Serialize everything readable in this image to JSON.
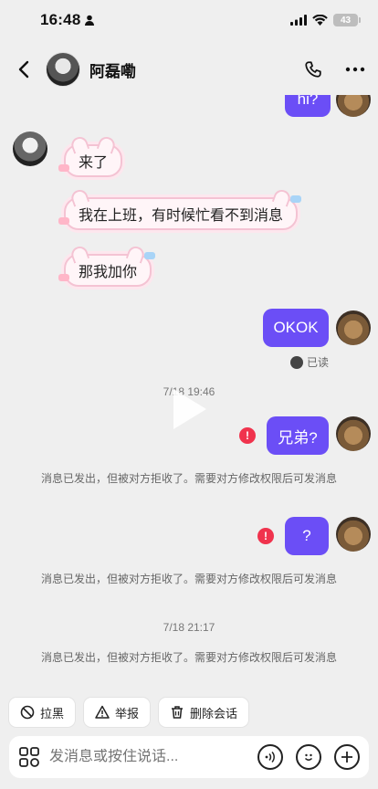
{
  "status_bar": {
    "time": "16:48",
    "battery": "43"
  },
  "header": {
    "contact_name": "阿磊嘞"
  },
  "messages": {
    "me_top": "hi?",
    "other_1": "来了",
    "other_2": "我在上班，有时候忙看不到消息",
    "other_3": "那我加你",
    "me_okok": "OKOK",
    "read_label": "已读",
    "timestamp_1": "7/18 19:46",
    "me_brother": "兄弟?",
    "error_mark": "!",
    "rejected_notice": "消息已发出，但被对方拒收了。需要对方修改权限后可发消息",
    "me_question": "?",
    "timestamp_2": "7/18 21:17"
  },
  "quick_actions": {
    "block": "拉黑",
    "report": "举报",
    "delete_chat": "删除会话"
  },
  "input": {
    "placeholder": "发消息或按住说话..."
  },
  "colors": {
    "accent": "#6b4ef6",
    "error": "#f0334d",
    "cat_border": "#f4c3d3"
  }
}
